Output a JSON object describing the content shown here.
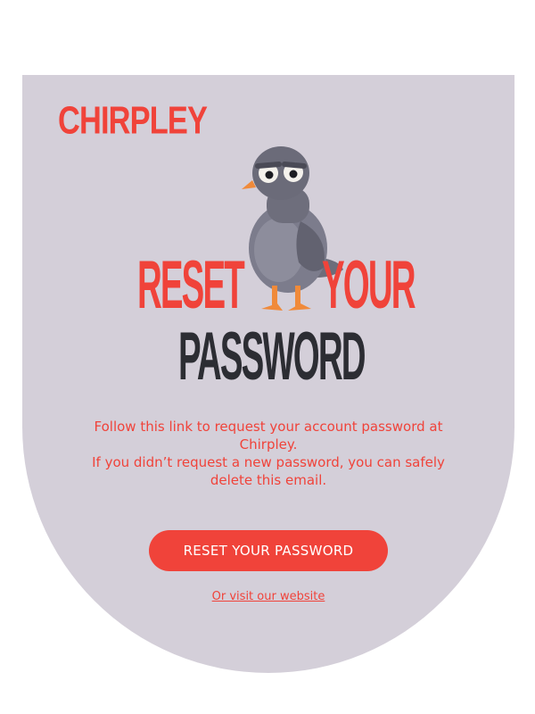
{
  "brand": {
    "logo_text": "CHIRPLEY",
    "accent_color": "#f0433a",
    "card_color": "#d4cfd9",
    "heading_dark_color": "#2c2d33"
  },
  "hero": {
    "title_word_1": "RESET",
    "title_word_2": "YOUR",
    "title_word_3": "PASSWORD",
    "mascot_icon": "pigeon-mascot-icon"
  },
  "message": {
    "line_1": "Follow this link to request your account password at Chirpley.",
    "line_2": "If you didn’t request a new password, you can safely delete this email."
  },
  "actions": {
    "reset_button_label": "RESET YOUR PASSWORD",
    "website_link_label": "Or visit our website"
  }
}
